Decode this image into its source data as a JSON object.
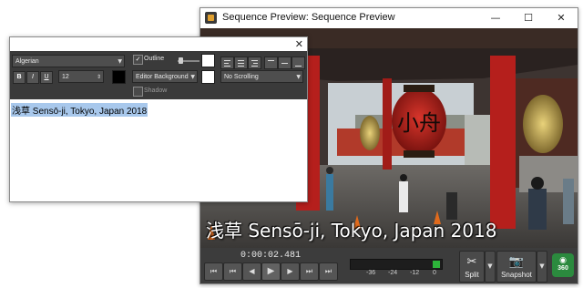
{
  "preview": {
    "title": "Sequence Preview: Sequence Preview",
    "minimize_glyph": "—",
    "maximize_glyph": "☐",
    "close_glyph": "✕",
    "caption": "浅草 Sensō-ji, Tokyo, Japan 2018",
    "timecode": "0:00:02.481",
    "transport": [
      "⏮",
      "⏮",
      "◀",
      "▶",
      "▶",
      "⏭",
      "⏭"
    ],
    "meter_scale": [
      "-36",
      "-24",
      "-12",
      "0"
    ],
    "split_label": "Split",
    "snapshot_label": "Snapshot",
    "badge_360": "360",
    "split_icon": "scissors-icon",
    "snapshot_icon": "camera-icon",
    "colors": {
      "meter_level": "#2db33a",
      "badge": "#2b8a3e"
    }
  },
  "editor": {
    "close_glyph": "✕",
    "font": "Algerian",
    "bold": "B",
    "italic": "I",
    "underline": "U",
    "size": "12",
    "outline_label": "Outline",
    "outline_checked": true,
    "background_option": "Editor Background",
    "shadow_label": "Shadow",
    "scroll_option": "No Scrolling",
    "text": "浅草 Sensō-ji, Tokyo, Japan 2018",
    "colors": {
      "text_color": "#000000",
      "outline_color": "#ffffff",
      "background_color": "#ffffff",
      "selection": "#a8c8ec"
    }
  }
}
